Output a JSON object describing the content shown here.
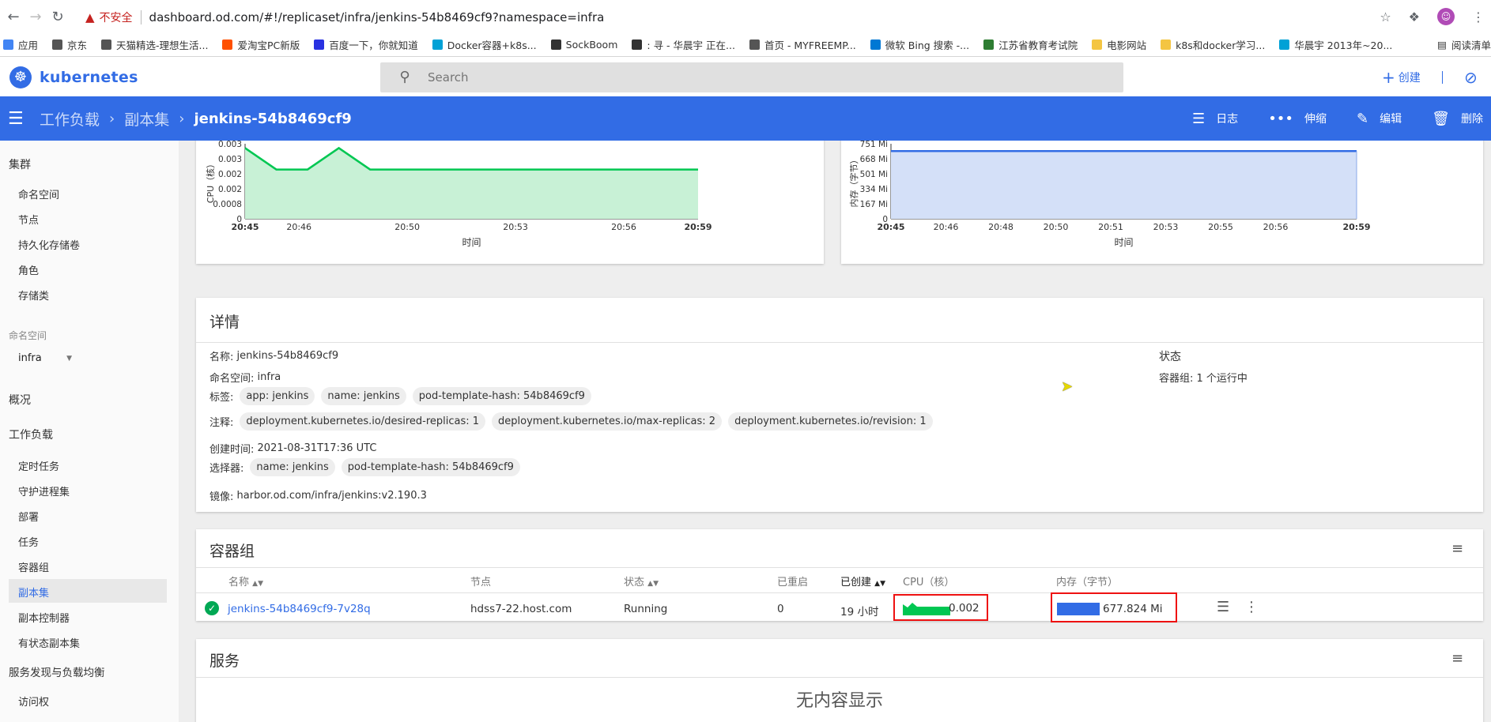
{
  "browser": {
    "insecure_label": "不安全",
    "url": "dashboard.od.com/#!/replicaset/infra/jenkins-54b8469cf9?namespace=infra",
    "bookmarks": [
      {
        "label": "应用",
        "color": "#4285f4"
      },
      {
        "label": "京东",
        "color": "#555555"
      },
      {
        "label": "天猫精选-理想生活...",
        "color": "#555555"
      },
      {
        "label": "爱淘宝PC新版",
        "color": "#ff5000"
      },
      {
        "label": "百度一下，你就知道",
        "color": "#2932e1"
      },
      {
        "label": "Docker容器+k8s...",
        "color": "#00a1d6"
      },
      {
        "label": "SockBoom",
        "color": "#333333"
      },
      {
        "label": ": 寻 - 华晨宇 正在...",
        "color": "#333333"
      },
      {
        "label": "首页 - MYFREEMP...",
        "color": "#555555"
      },
      {
        "label": "微软 Bing 搜索 -...",
        "color": "#0078d4"
      },
      {
        "label": "江苏省教育考试院",
        "color": "#2e7d32"
      },
      {
        "label": "电影网站",
        "color": "#f4c542"
      },
      {
        "label": "k8s和docker学习...",
        "color": "#f4c542"
      },
      {
        "label": "华晨宇 2013年~20...",
        "color": "#00a1d6"
      }
    ],
    "reading_list": "阅读清单"
  },
  "app": {
    "logo_text": "kubernetes",
    "search_placeholder": "Search",
    "create_label": "创建"
  },
  "actionbar": {
    "breadcrumb": [
      "工作负载",
      "副本集",
      "jenkins-54b8469cf9"
    ],
    "actions": [
      "日志",
      "伸缩",
      "编辑",
      "删除"
    ]
  },
  "sidebar": {
    "cluster": "集群",
    "cluster_items": [
      "命名空间",
      "节点",
      "持久化存储卷",
      "角色",
      "存储类"
    ],
    "namespace_label": "命名空间",
    "namespace_value": "infra",
    "overview": "概况",
    "workloads": "工作负载",
    "workload_items": [
      "定时任务",
      "守护进程集",
      "部署",
      "任务",
      "容器组",
      "副本集",
      "副本控制器",
      "有状态副本集"
    ],
    "discovery": "服务发现与负载均衡",
    "discovery_items": [
      "访问权"
    ]
  },
  "cpu_chart": {
    "ylabel": "CPU（核）",
    "xlabel": "时间",
    "yticks": [
      "0.003",
      "0.003",
      "0.002",
      "0.002",
      "0.0008",
      "0"
    ],
    "xticks": [
      "20:45",
      "20:46",
      "20:50",
      "20:53",
      "20:56",
      "20:59"
    ],
    "color": "#00c752"
  },
  "mem_chart": {
    "ylabel": "内存（字节）",
    "xlabel": "时间",
    "yticks": [
      "751 Mi",
      "668 Mi",
      "501 Mi",
      "334 Mi",
      "167 Mi",
      "0"
    ],
    "xticks": [
      "20:45",
      "20:46",
      "20:48",
      "20:50",
      "20:51",
      "20:53",
      "20:55",
      "20:56",
      "20:59"
    ],
    "color": "#326ce5"
  },
  "chart_data": [
    {
      "type": "area",
      "ylabel": "CPU（核）",
      "xlabel": "时间",
      "x": [
        "20:45",
        "20:46",
        "20:47",
        "20:48",
        "20:49",
        "20:50",
        "20:53",
        "20:56",
        "20:59"
      ],
      "values": [
        0.0033,
        0.0023,
        0.0023,
        0.0033,
        0.0023,
        0.0023,
        0.0023,
        0.0023,
        0.0023
      ],
      "ylim": [
        0,
        0.0035
      ]
    },
    {
      "type": "area",
      "ylabel": "内存（字节）",
      "xlabel": "时间",
      "x": [
        "20:45",
        "20:59"
      ],
      "values": [
        678,
        678
      ],
      "unit": "Mi",
      "ylim": [
        0,
        751
      ]
    }
  ],
  "details": {
    "title": "详情",
    "name_label": "名称:",
    "name": "jenkins-54b8469cf9",
    "namespace_label": "命名空间:",
    "namespace": "infra",
    "labels_label": "标签:",
    "labels": [
      "app: jenkins",
      "name: jenkins",
      "pod-template-hash: 54b8469cf9"
    ],
    "annotations_label": "注释:",
    "annotations": [
      "deployment.kubernetes.io/desired-replicas: 1",
      "deployment.kubernetes.io/max-replicas: 2",
      "deployment.kubernetes.io/revision: 1"
    ],
    "created_label": "创建时间:",
    "created": "2021-08-31T17:36 UTC",
    "selector_label": "选择器:",
    "selector": [
      "name: jenkins",
      "pod-template-hash: 54b8469cf9"
    ],
    "image_label": "镜像:",
    "image": "harbor.od.com/infra/jenkins:v2.190.3",
    "status_title": "状态",
    "pods_status": "容器组: 1 个运行中"
  },
  "pods": {
    "title": "容器组",
    "headers": [
      "名称",
      "节点",
      "状态",
      "已重启",
      "已创建",
      "CPU（核）",
      "内存（字节）"
    ],
    "rows": [
      {
        "name": "jenkins-54b8469cf9-7v28q",
        "node": "hdss7-22.host.com",
        "status": "Running",
        "restarts": "0",
        "age": "19 小时",
        "cpu": "0.002",
        "memory": "677.824 Mi"
      }
    ]
  },
  "services": {
    "title": "服务",
    "empty": "无内容显示"
  }
}
